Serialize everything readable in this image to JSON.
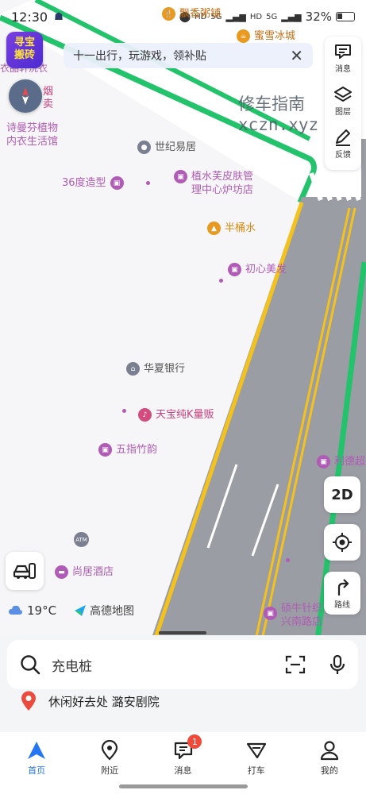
{
  "status_bar": {
    "time": "12:30",
    "net1": "HD",
    "net1_gen": "5G",
    "net2": "HD",
    "net2_gen": "5G",
    "battery": "32%"
  },
  "map": {
    "top_pois": {
      "food": "飘香粥铺",
      "drink": "蜜雪冰城"
    },
    "edge_labels": {
      "top_left": "衣品轩洗衣",
      "left1": "烟",
      "left2": "卖"
    },
    "watermark": {
      "line1": "修车指南",
      "line2": "xczn.xyz"
    },
    "pois": [
      {
        "line1": "诗曼芬植物",
        "line2": "内衣生活馆"
      },
      {
        "name": "世纪易居"
      },
      {
        "name": "36度造型"
      },
      {
        "line1": "植水芙皮肤管",
        "line2": "理中心炉坊店"
      },
      {
        "name": "半桶水"
      },
      {
        "name": "初心美发"
      },
      {
        "name": "华夏银行"
      },
      {
        "name": "天宝纯K量贩"
      },
      {
        "name": "五指竹韵"
      },
      {
        "name": "利德超"
      },
      {
        "name": "ATM"
      },
      {
        "name": "尚居酒店"
      },
      {
        "line1": "硕牛针织",
        "line2": "兴南路店"
      }
    ]
  },
  "overlays": {
    "game_badge": {
      "line1": "寻宝",
      "line2": "搬砖"
    },
    "notice_text": "十一出行，玩游戏，领补贴",
    "side_panel": [
      {
        "label": "消息",
        "icon": "message-icon"
      },
      {
        "label": "图层",
        "icon": "layers-icon"
      },
      {
        "label": "反馈",
        "icon": "feedback-icon"
      }
    ],
    "view_mode": "2D",
    "route_label": "路线",
    "weather": {
      "temp": "19°C",
      "brand": "高德地图"
    }
  },
  "search": {
    "placeholder": "充电桩"
  },
  "suggestion": "休闲好去处 潞安剧院",
  "tabs": [
    {
      "label": "首页",
      "icon": "home-icon",
      "active": true
    },
    {
      "label": "附近",
      "icon": "nearby-icon"
    },
    {
      "label": "消息",
      "icon": "chat-icon",
      "badge": "1"
    },
    {
      "label": "打车",
      "icon": "taxi-icon"
    },
    {
      "label": "我的",
      "icon": "profile-icon"
    }
  ],
  "colors": {
    "accent": "#2476f5",
    "road_edge": "#22c36b",
    "road_line": "#f4c21b",
    "poi_pink": "#b05bb5"
  }
}
